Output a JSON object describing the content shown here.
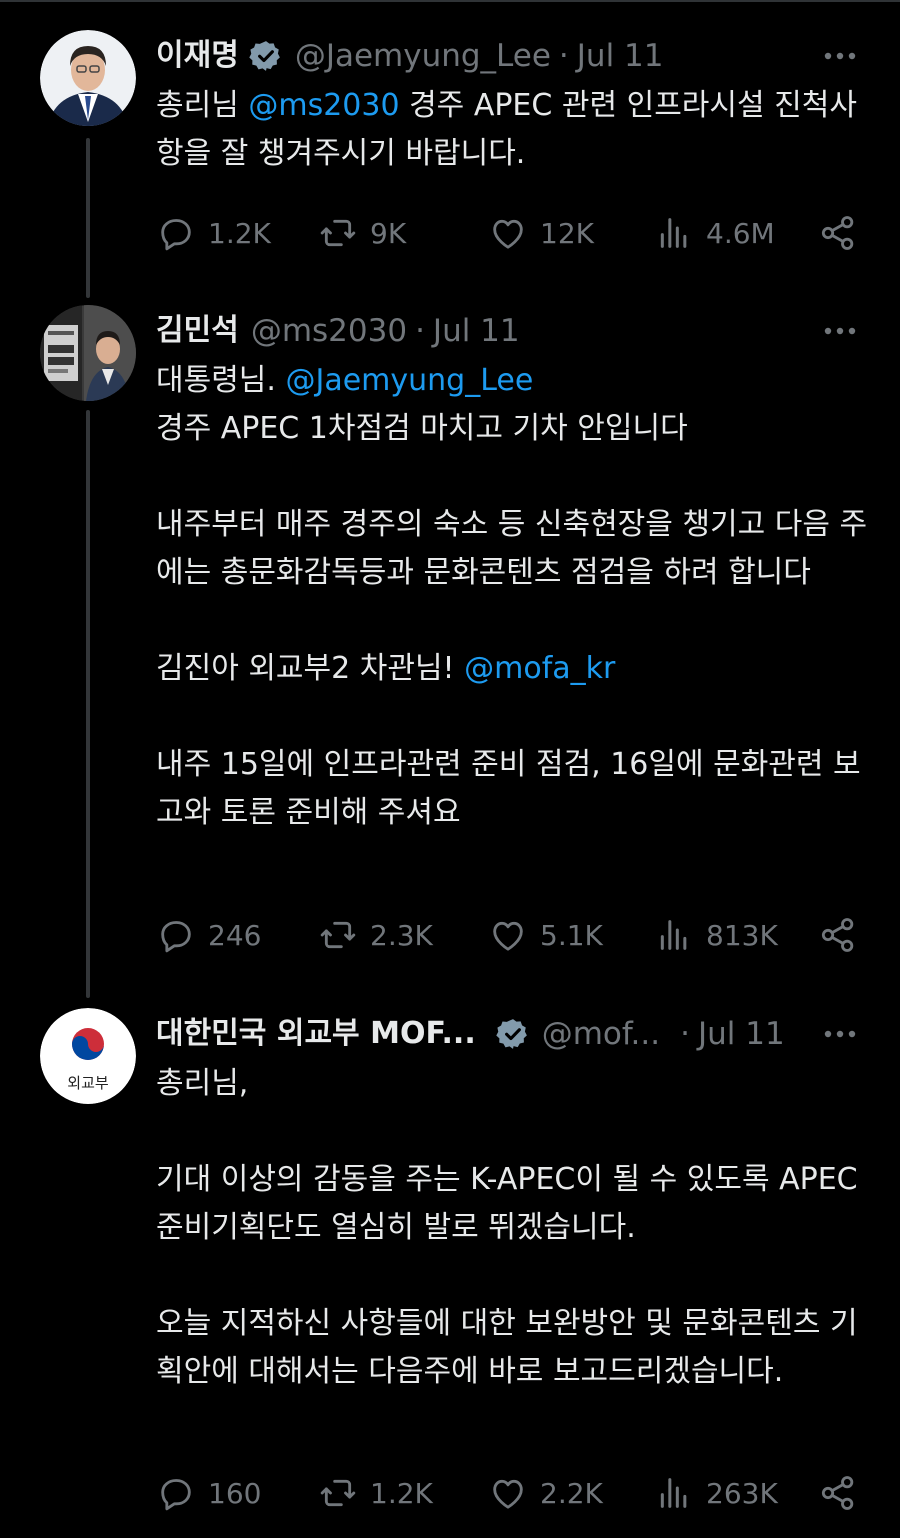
{
  "tweets": [
    {
      "name": "이재명",
      "handle": "@Jaemyung_Lee",
      "dot": "·",
      "date": "Jul 11",
      "text_pre": "총리님 ",
      "mention": "@ms2030",
      "text_post": " 경주 APEC 관련 인프라시설 진척사항을 잘 챙겨주시기 바랍니다.",
      "stats": {
        "replies": "1.2K",
        "retweets": "9K",
        "likes": "12K",
        "views": "4.6M"
      }
    },
    {
      "name": "김민석",
      "handle": "@ms2030",
      "dot": "·",
      "date": "Jul 11",
      "line1_pre": "대통령님. ",
      "line1_mention": "@Jaemyung_Lee",
      "line2": "경주 APEC 1차점검 마치고 기차 안입니다",
      "para2": "내주부터 매주 경주의 숙소 등 신축현장을 챙기고 다음 주에는 총문화감독등과 문화콘텐츠 점검을 하려 합니다",
      "para3_pre": "김진아 외교부2 차관님! ",
      "para3_mention": "@mofa_kr",
      "para4": "내주 15일에 인프라관련 준비 점검, 16일에 문화관련 보고와 토론 준비해 주셔요",
      "stats": {
        "replies": "246",
        "retweets": "2.3K",
        "likes": "5.1K",
        "views": "813K"
      }
    },
    {
      "name": "대한민국 외교부 MOF...",
      "handle": "@mof...",
      "dot": "·",
      "date": "Jul 11",
      "avatar_label": "외교부",
      "para1": "총리님,",
      "para2": "기대 이상의 감동을 주는 K-APEC이 될 수 있도록 APEC 준비기획단도 열심히 발로 뛰겠습니다.",
      "para3": "오늘 지적하신 사항들에 대한 보완방안 및 문화콘텐츠 기획안에 대해서는 다음주에 바로 보고드리겠습니다.",
      "stats": {
        "replies": "160",
        "retweets": "1.2K",
        "likes": "2.2K",
        "views": "263K"
      }
    }
  ],
  "colors": {
    "background": "#000000",
    "text": "#e7e9ea",
    "muted": "#71767b",
    "link": "#1d9bf0",
    "thread_line": "#333639"
  },
  "icons": [
    "verified-badge-icon",
    "more-icon",
    "reply-icon",
    "retweet-icon",
    "like-icon",
    "views-icon",
    "share-icon"
  ]
}
